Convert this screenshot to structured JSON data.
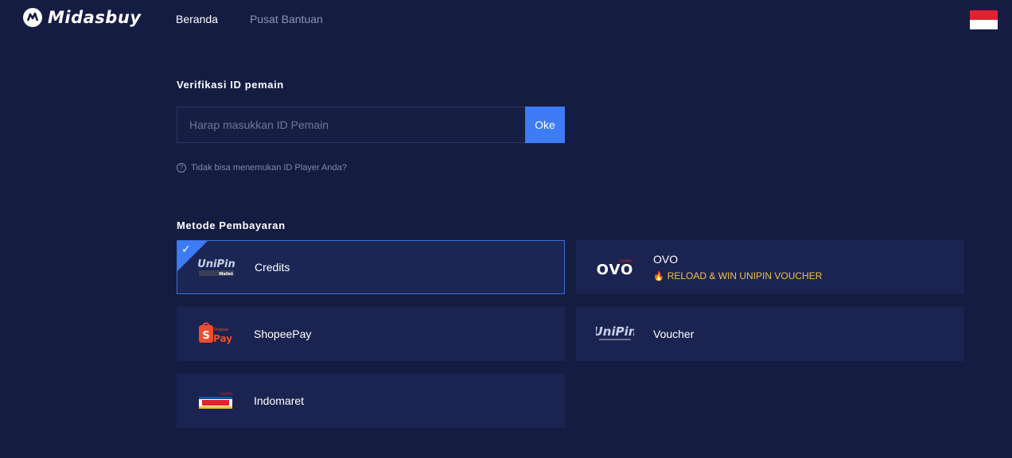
{
  "header": {
    "brand": "Midasbuy",
    "nav": [
      {
        "label": "Beranda",
        "active": true
      },
      {
        "label": "Pusat Bantuan",
        "active": false
      }
    ],
    "flag": "indonesia-flag"
  },
  "verification": {
    "title": "Verifikasi ID pemain",
    "input_value": "",
    "input_placeholder": "Harap masukkan ID Pemain",
    "ok_label": "Oke",
    "help_text": "Tidak bisa menemukan ID Player Anda?"
  },
  "payment": {
    "title": "Metode Pembayaran",
    "methods": [
      {
        "name": "Credits",
        "logo": "unipin-wallet-logo",
        "selected": true
      },
      {
        "name": "OVO",
        "logo": "ovo-logo",
        "promo": "RELOAD & WIN UNIPIN VOUCHER",
        "selected": false
      },
      {
        "name": "ShopeePay",
        "logo": "shopeepay-logo",
        "selected": false
      },
      {
        "name": "Voucher",
        "logo": "unipin-voucher-logo",
        "selected": false
      },
      {
        "name": "Indomaret",
        "logo": "indomaret-logo",
        "selected": false
      }
    ]
  },
  "colors": {
    "background": "#141c42",
    "card": "#1b2450",
    "accent": "#3d7bf7",
    "promo": "#f0c04a"
  }
}
